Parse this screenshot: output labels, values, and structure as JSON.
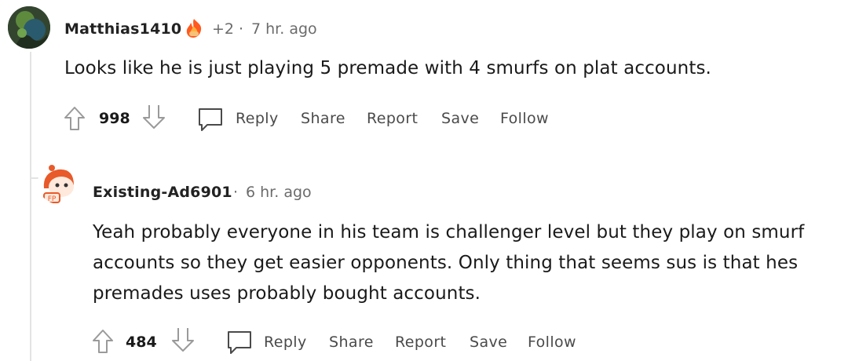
{
  "comments": [
    {
      "username": "Matthias1410",
      "flair_icon": "fire-hand-award-icon",
      "award_count": "+2",
      "separator": "·",
      "time": "7 hr. ago",
      "body": "Looks like he is just playing 5 premade with 4 smurfs on plat accounts.",
      "votes": "998",
      "actions": {
        "reply": "Reply",
        "share": "Share",
        "report": "Report",
        "save": "Save",
        "follow": "Follow"
      }
    },
    {
      "username": "Existing-Ad6901",
      "separator": "·",
      "time": "6 hr. ago",
      "body_lines": [
        "Yeah probably everyone in his team is challenger level but they play on smurf",
        "accounts so they get easier opponents. Only thing that seems sus is that hes",
        "premades uses probably bought accounts."
      ],
      "votes": "484",
      "actions": {
        "reply": "Reply",
        "share": "Share",
        "report": "Report",
        "save": "Save",
        "follow": "Follow"
      }
    }
  ],
  "colors": {
    "accent_orange": "#ff4500",
    "muted_text": "#6b6b6b",
    "thread_line": "#e3e3e3"
  }
}
